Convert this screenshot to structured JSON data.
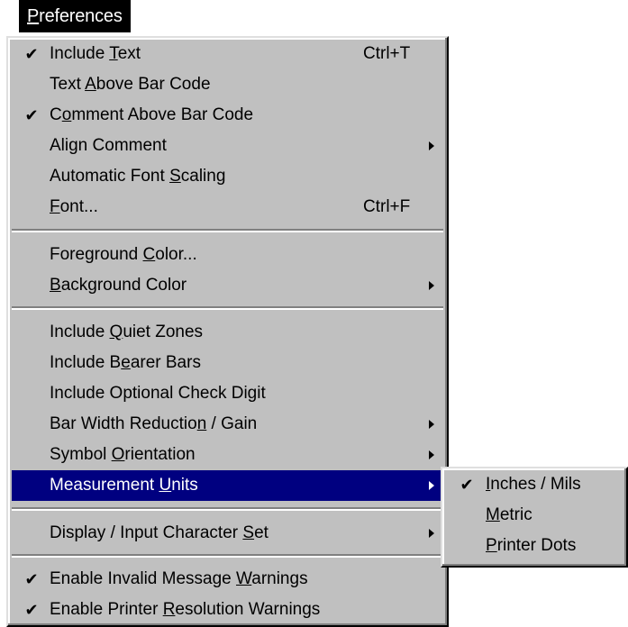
{
  "menubar": {
    "title_accel": "P",
    "title_rest": "references"
  },
  "menu": {
    "items": [
      {
        "pre": "Include ",
        "accel": "T",
        "post": "ext",
        "checked": true,
        "shortcut": "Ctrl+T",
        "submenu": false
      },
      {
        "pre": "Text ",
        "accel": "A",
        "post": "bove Bar Code",
        "checked": false,
        "shortcut": "",
        "submenu": false
      },
      {
        "pre": "C",
        "accel": "o",
        "post": "mment Above Bar Code",
        "checked": true,
        "shortcut": "",
        "submenu": false
      },
      {
        "pre": "Align Comment",
        "accel": "",
        "post": "",
        "checked": false,
        "shortcut": "",
        "submenu": true
      },
      {
        "pre": "Automatic Font ",
        "accel": "S",
        "post": "caling",
        "checked": false,
        "shortcut": "",
        "submenu": false
      },
      {
        "pre": "",
        "accel": "F",
        "post": "ont...",
        "checked": false,
        "shortcut": "Ctrl+F",
        "submenu": false
      },
      {
        "pre": "Foreground ",
        "accel": "C",
        "post": "olor...",
        "checked": false,
        "shortcut": "",
        "submenu": false
      },
      {
        "pre": "",
        "accel": "B",
        "post": "ackground Color",
        "checked": false,
        "shortcut": "",
        "submenu": true
      },
      {
        "pre": "Include ",
        "accel": "Q",
        "post": "uiet Zones",
        "checked": false,
        "shortcut": "",
        "submenu": false
      },
      {
        "pre": "Include B",
        "accel": "e",
        "post": "arer Bars",
        "checked": false,
        "shortcut": "",
        "submenu": false
      },
      {
        "pre": "Include Optional Check Digit",
        "accel": "",
        "post": "",
        "checked": false,
        "shortcut": "",
        "submenu": false
      },
      {
        "pre": "Bar Width Reductio",
        "accel": "n",
        "post": " / Gain",
        "checked": false,
        "shortcut": "",
        "submenu": true
      },
      {
        "pre": "Symbol ",
        "accel": "O",
        "post": "rientation",
        "checked": false,
        "shortcut": "",
        "submenu": true
      },
      {
        "pre": "Measurement ",
        "accel": "U",
        "post": "nits",
        "checked": false,
        "shortcut": "",
        "submenu": true,
        "highlighted": true
      },
      {
        "pre": "Display / Input Character ",
        "accel": "S",
        "post": "et",
        "checked": false,
        "shortcut": "",
        "submenu": true
      },
      {
        "pre": "Enable Invalid Message ",
        "accel": "W",
        "post": "arnings",
        "checked": true,
        "shortcut": "",
        "submenu": false
      },
      {
        "pre": "Enable Printer ",
        "accel": "R",
        "post": "esolution Warnings",
        "checked": true,
        "shortcut": "",
        "submenu": false
      }
    ],
    "check_glyph": "✔"
  },
  "submenu": {
    "items": [
      {
        "pre": "",
        "accel": "I",
        "post": "nches / Mils",
        "checked": true
      },
      {
        "pre": "",
        "accel": "M",
        "post": "etric",
        "checked": false
      },
      {
        "pre": "",
        "accel": "P",
        "post": "rinter Dots",
        "checked": false
      }
    ]
  },
  "colors": {
    "menu_bg": "#c0c0c0",
    "highlight_bg": "#000080",
    "highlight_text": "#ffffff"
  }
}
